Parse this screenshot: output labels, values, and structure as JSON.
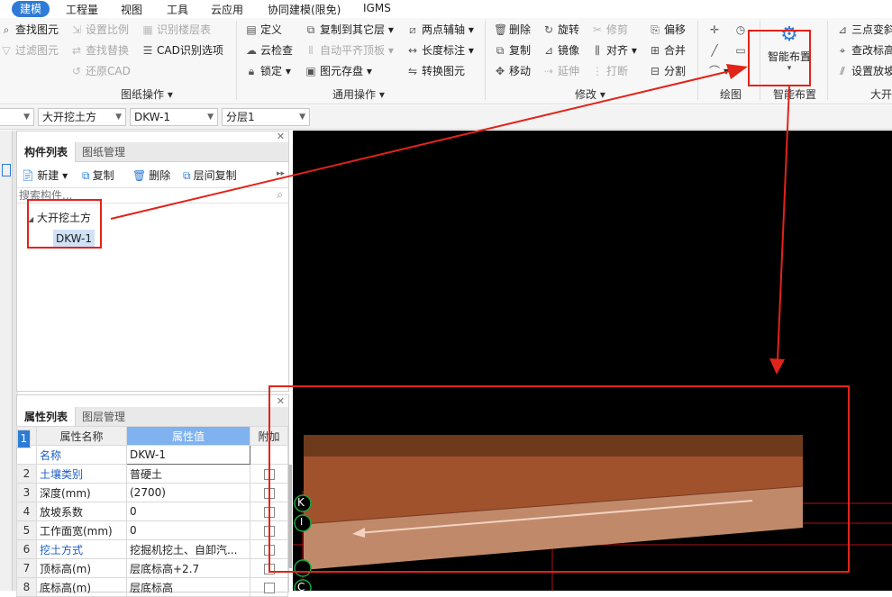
{
  "menubar": {
    "items": [
      "建模",
      "工程量",
      "视图",
      "工具",
      "云应用",
      "协同建模(限免)",
      "IGMS"
    ]
  },
  "ribbon": {
    "drawing_ops": {
      "items": [
        "查找图元",
        "过滤图元",
        "设置比例",
        "查找替换",
        "还原CAD",
        "识别楼层表",
        "CAD识别选项"
      ],
      "label": "图纸操作"
    },
    "general_ops": {
      "items": [
        "定义",
        "云检查",
        "锁定",
        "复制到其它层",
        "自动平齐顶板",
        "图元存盘",
        "两点辅轴",
        "长度标注",
        "转换图元"
      ],
      "label": "通用操作"
    },
    "modify": {
      "items": [
        "删除",
        "复制",
        "移动",
        "旋转",
        "镜像",
        "延伸",
        "修剪",
        "对齐",
        "打断",
        "偏移",
        "合并",
        "分割"
      ],
      "label": "修改"
    },
    "draw": {
      "label": "绘图"
    },
    "smart": {
      "button_label": "智能布置",
      "label": "智能布置"
    },
    "right": {
      "items": [
        "三点变斜",
        "查改标高",
        "设置放坡"
      ],
      "label": "大开"
    }
  },
  "selectors": {
    "type": "大开挖土方",
    "component": "DKW-1",
    "layer": "分层1"
  },
  "component_panel": {
    "tabs": [
      "构件列表",
      "图纸管理"
    ],
    "toolbar": [
      "新建",
      "复制",
      "删除",
      "层间复制"
    ],
    "search_placeholder": "搜索构件...",
    "tree": {
      "parent": "大开挖土方",
      "child": "DKW-1"
    }
  },
  "property_panel": {
    "tabs": [
      "属性列表",
      "图层管理"
    ],
    "headers": [
      "属性名称",
      "属性值",
      "附加"
    ],
    "rows": [
      {
        "no": "1",
        "name": "名称",
        "value": "DKW-1"
      },
      {
        "no": "2",
        "name": "土壤类别",
        "value": "普硬土"
      },
      {
        "no": "3",
        "name": "深度(mm)",
        "value": "(2700)"
      },
      {
        "no": "4",
        "name": "放坡系数",
        "value": "0"
      },
      {
        "no": "5",
        "name": "工作面宽(mm)",
        "value": "0"
      },
      {
        "no": "6",
        "name": "挖土方式",
        "value": "挖掘机挖土、自卸汽..."
      },
      {
        "no": "7",
        "name": "顶标高(m)",
        "value": "层底标高+2.7"
      },
      {
        "no": "8",
        "name": "底标高(m)",
        "value": "层底标高"
      }
    ]
  },
  "canvas": {
    "axis_labels": [
      "K",
      "I",
      "C"
    ]
  },
  "colors": {
    "accent": "#2d7bd7",
    "highlight_red": "#e2231a"
  }
}
